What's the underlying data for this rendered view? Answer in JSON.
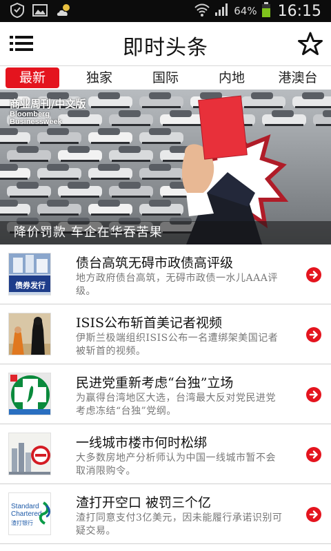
{
  "status_bar": {
    "battery_percent": "64%",
    "time": "16:15",
    "icons": [
      "shield-icon",
      "image-icon",
      "weather-icon",
      "wifi-icon",
      "signal-icon",
      "battery-icon"
    ]
  },
  "header": {
    "title": "即时头条",
    "menu_icon": "menu-icon",
    "favorite_icon": "star-icon"
  },
  "tabs": [
    {
      "label": "最新",
      "active": true
    },
    {
      "label": "独家",
      "active": false
    },
    {
      "label": "国际",
      "active": false
    },
    {
      "label": "内地",
      "active": false
    },
    {
      "label": "港澳台",
      "active": false
    }
  ],
  "hero": {
    "magazine_cn": "商业周刊/中文版",
    "magazine_en_1": "Bloomberg",
    "magazine_en_2": "Businessweek",
    "caption": "降价罚款 车企在华吞苦果"
  },
  "news": [
    {
      "title": "债台高筑无碍市政债高评级",
      "desc": "地方政府债台高筑，无碍市政债一水儿AAA评级。",
      "thumb_label": "债券发行",
      "thumb": "bond-thumbnail"
    },
    {
      "title": "ISIS公布斩首美记者视频",
      "desc": "伊斯兰极端组织ISIS公布一名遭绑架美国记者被斩首的视频。",
      "thumb": "hostage-thumbnail"
    },
    {
      "title": "民进党重新考虑“台独”立场",
      "desc": "为赢得台湾地区大选，台湾最大反对党民进党考虑冻结“台独”党纲。",
      "thumb": "party-flag-thumbnail"
    },
    {
      "title": "一线城市楼市何时松绑",
      "desc": "大多数房地产分析师认为中国一线城市暂不会取消限购令。",
      "thumb": "city-thumbnail"
    },
    {
      "title": "渣打开空口 被罚三个亿",
      "desc": "渣打同意支付3亿美元，因未能履行承诺识别可疑交易。",
      "thumb_label_1": "Standard",
      "thumb_label_2": "Chartered",
      "thumb_label_3": "渣打银行",
      "thumb": "bank-logo-thumbnail"
    }
  ],
  "colors": {
    "accent": "#e4141e",
    "status_bar": "#0c0c0c",
    "battery": "#7fc31c"
  }
}
